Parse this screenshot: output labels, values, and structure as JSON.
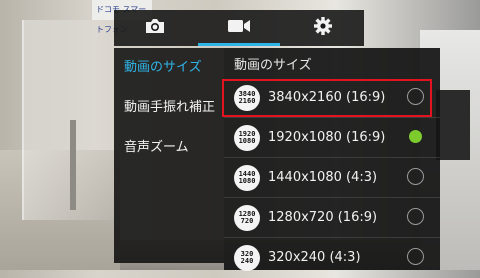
{
  "tabs": [
    {
      "icon": "camera-icon",
      "active": false
    },
    {
      "icon": "video-camera-icon",
      "active": true
    },
    {
      "icon": "gear-icon",
      "active": false
    }
  ],
  "menu": [
    {
      "label": "動画のサイズ",
      "selected": true
    },
    {
      "label": "動画手振れ補正",
      "selected": false
    },
    {
      "label": "音声ズーム",
      "selected": false
    }
  ],
  "panel": {
    "title": "動画のサイズ",
    "options": [
      {
        "icon_top": "3840",
        "icon_bottom": "2160",
        "label": "3840x2160 (16:9)",
        "checked": false,
        "highlighted": true
      },
      {
        "icon_top": "1920",
        "icon_bottom": "1080",
        "label": "1920x1080 (16:9)",
        "checked": true,
        "highlighted": false
      },
      {
        "icon_top": "1440",
        "icon_bottom": "1080",
        "label": "1440x1080 (4:3)",
        "checked": false,
        "highlighted": false
      },
      {
        "icon_top": "1280",
        "icon_bottom": "720",
        "label": "1280x720 (16:9)",
        "checked": false,
        "highlighted": false
      },
      {
        "icon_top": "320",
        "icon_bottom": "240",
        "label": "320x240 (4:3)",
        "checked": false,
        "highlighted": false
      }
    ]
  },
  "background": {
    "sign_text": "ドコモ スマートフォン"
  },
  "colors": {
    "accent": "#2fb4e8",
    "checked": "#7ecb2e",
    "highlight_box": "#e3141f"
  }
}
